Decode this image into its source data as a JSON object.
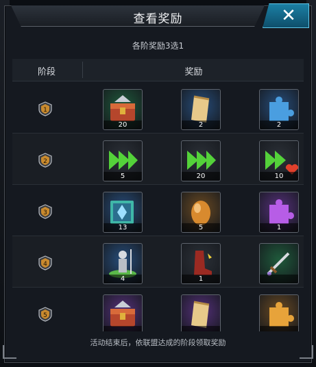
{
  "dialog": {
    "title": "查看奖励",
    "subtitle": "各阶奖励3选1",
    "close_icon": "close-icon",
    "header": {
      "tier_label": "阶段",
      "reward_label": "奖励"
    },
    "footer": "活动结束后，依联盟达成的阶段领取奖励"
  },
  "rows": [
    {
      "tier": "1",
      "items": [
        {
          "icon": "treasure-chest-icon",
          "count": "20",
          "bg": "#1f5a3b"
        },
        {
          "icon": "scroll-icon",
          "count": "2",
          "bg": "#274d7a"
        },
        {
          "icon": "puzzle-piece-icon",
          "count": "2",
          "bg": "#274d7a"
        }
      ]
    },
    {
      "tier": "2",
      "items": [
        {
          "icon": "speedup-arrows-icon",
          "count": "5",
          "bg": "#2c3138"
        },
        {
          "icon": "speedup-arrows-icon",
          "count": "20",
          "bg": "#2c3138"
        },
        {
          "icon": "speedup-heart-icon",
          "count": "10",
          "bg": "#2c3138"
        }
      ]
    },
    {
      "tier": "3",
      "items": [
        {
          "icon": "book-icon",
          "count": "13",
          "bg": "#274d7a"
        },
        {
          "icon": "egg-icon",
          "count": "5",
          "bg": "#6a4a22"
        },
        {
          "icon": "puzzle-piece-icon",
          "count": "1",
          "bg": "#55307a"
        }
      ]
    },
    {
      "tier": "4",
      "items": [
        {
          "icon": "soldier-icon",
          "count": "4",
          "bg": "#274d7a"
        },
        {
          "icon": "boots-icon",
          "count": "1",
          "bg": "#2c3138"
        },
        {
          "icon": "sword-icon",
          "count": "",
          "bg": "#1f5a3b"
        }
      ]
    },
    {
      "tier": "5",
      "items": [
        {
          "icon": "treasure-chest-icon",
          "count": "",
          "bg": "#55307a"
        },
        {
          "icon": "scroll-icon",
          "count": "",
          "bg": "#55307a"
        },
        {
          "icon": "puzzle-piece-icon",
          "count": "",
          "bg": "#6a4a22"
        }
      ]
    }
  ]
}
